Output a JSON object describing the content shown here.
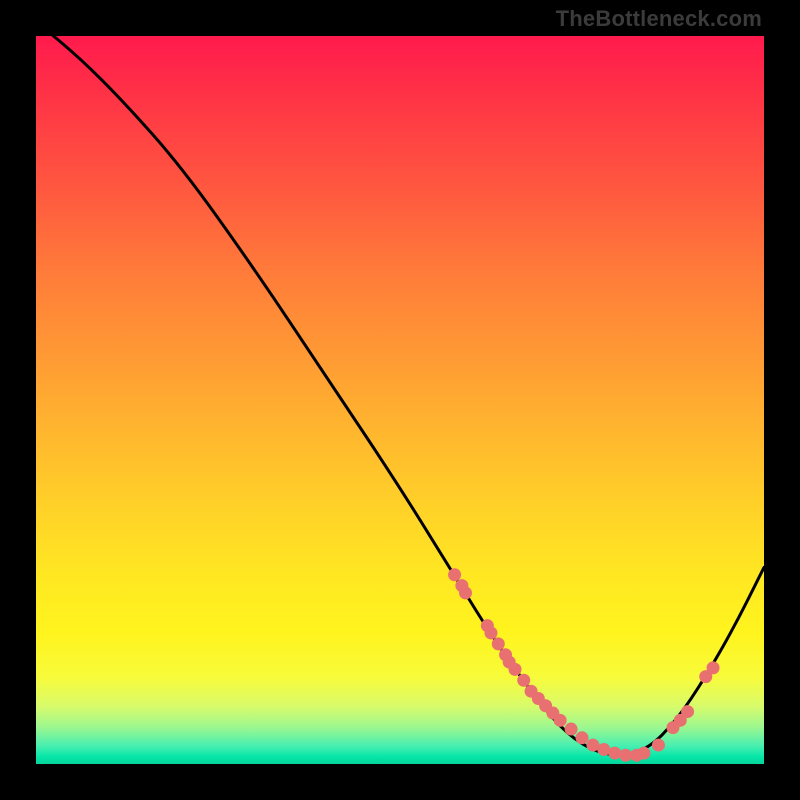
{
  "watermark": "TheBottleneck.com",
  "colors": {
    "background": "#000000",
    "curve": "#000000",
    "dot": "#e97070"
  },
  "chart_data": {
    "type": "line",
    "title": "",
    "xlabel": "",
    "ylabel": "",
    "xlim": [
      0,
      100
    ],
    "ylim": [
      0,
      100
    ],
    "grid": false,
    "legend": false,
    "series": [
      {
        "name": "curve",
        "x": [
          0,
          6,
          12,
          20,
          30,
          40,
          50,
          58,
          63,
          68,
          72,
          76,
          80,
          84,
          88,
          92,
          96,
          100
        ],
        "y": [
          102,
          97,
          91,
          82,
          68,
          53,
          38,
          25,
          17,
          10,
          5,
          2,
          1,
          2,
          6,
          12,
          19,
          27
        ]
      }
    ],
    "scatter": [
      {
        "name": "dots",
        "x": [
          57.5,
          58.5,
          59.0,
          62.0,
          62.5,
          63.5,
          64.5,
          65.0,
          65.8,
          67.0,
          68.0,
          69.0,
          70.0,
          71.0,
          72.0,
          73.5,
          75.0,
          76.5,
          78.0,
          79.5,
          81.0,
          82.5,
          83.5,
          85.5,
          87.5,
          88.5,
          89.5,
          92.0,
          93.0
        ],
        "y": [
          26,
          24.5,
          23.5,
          19,
          18,
          16.5,
          15,
          14,
          13,
          11.5,
          10,
          9,
          8,
          7,
          6,
          4.8,
          3.6,
          2.6,
          2,
          1.5,
          1.2,
          1.2,
          1.5,
          2.6,
          5,
          6,
          7.2,
          12,
          13.2
        ]
      }
    ]
  }
}
